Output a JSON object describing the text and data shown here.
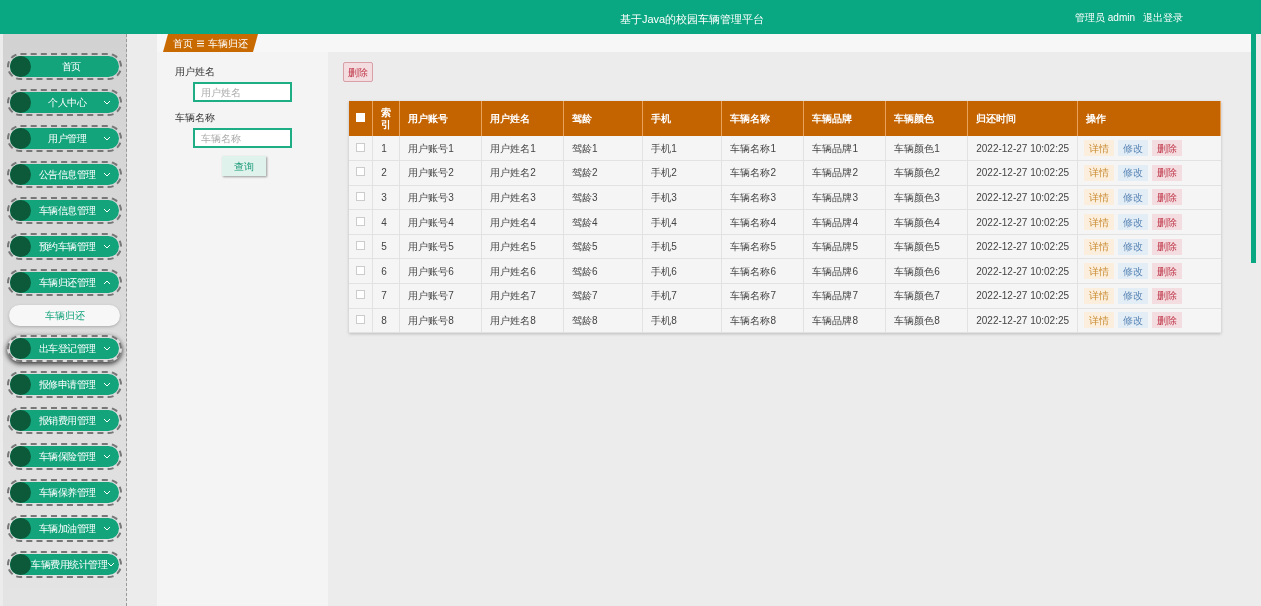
{
  "header": {
    "title": "基于Java的校园车辆管理平台",
    "user": "管理员 admin",
    "logout": "退出登录"
  },
  "sidebar": {
    "items": [
      {
        "label": "首页",
        "kind": "link",
        "hovered": false
      },
      {
        "label": "个人中心",
        "kind": "group",
        "expanded": false,
        "hovered": false
      },
      {
        "label": "用户管理",
        "kind": "group",
        "expanded": false,
        "hovered": false
      },
      {
        "label": "公告信息管理",
        "kind": "group",
        "expanded": false,
        "hovered": false
      },
      {
        "label": "车辆信息管理",
        "kind": "group",
        "expanded": false,
        "hovered": false
      },
      {
        "label": "预约车辆管理",
        "kind": "group",
        "expanded": false,
        "hovered": false
      },
      {
        "label": "车辆归还管理",
        "kind": "group",
        "expanded": true,
        "hovered": false,
        "children": [
          {
            "label": "车辆归还"
          }
        ]
      },
      {
        "label": "出车登记管理",
        "kind": "group",
        "expanded": false,
        "hovered": true
      },
      {
        "label": "报修申请管理",
        "kind": "group",
        "expanded": false,
        "hovered": false
      },
      {
        "label": "报销费用管理",
        "kind": "group",
        "expanded": false,
        "hovered": false
      },
      {
        "label": "车辆保险管理",
        "kind": "group",
        "expanded": false,
        "hovered": false
      },
      {
        "label": "车辆保养管理",
        "kind": "group",
        "expanded": false,
        "hovered": false
      },
      {
        "label": "车辆加油管理",
        "kind": "group",
        "expanded": false,
        "hovered": false
      },
      {
        "label": "车辆费用统计管理",
        "kind": "group",
        "expanded": false,
        "hovered": false
      }
    ]
  },
  "breadcrumb": [
    "首页",
    "车辆归还"
  ],
  "search": {
    "fields": [
      {
        "label": "用户姓名",
        "placeholder": "用户姓名"
      },
      {
        "label": "车辆名称",
        "placeholder": "车辆名称"
      }
    ],
    "button": "查询"
  },
  "toolbar": {
    "delete": "删除"
  },
  "table": {
    "columns": [
      "索引",
      "用户账号",
      "用户姓名",
      "驾龄",
      "手机",
      "车辆名称",
      "车辆品牌",
      "车辆颜色",
      "归还时间",
      "操作"
    ],
    "select_all": false,
    "rows": [
      {
        "checked": false,
        "cells": [
          "1",
          "用户账号1",
          "用户姓名1",
          "驾龄1",
          "手机1",
          "车辆名称1",
          "车辆品牌1",
          "车辆颜色1",
          "2022-12-27 10:02:25"
        ],
        "actions": [
          {
            "label": "详情",
            "kind": "detail"
          },
          {
            "label": "修改",
            "kind": "edit"
          },
          {
            "label": "删除",
            "kind": "delete"
          }
        ]
      },
      {
        "checked": false,
        "cells": [
          "2",
          "用户账号2",
          "用户姓名2",
          "驾龄2",
          "手机2",
          "车辆名称2",
          "车辆品牌2",
          "车辆颜色2",
          "2022-12-27 10:02:25"
        ],
        "actions": [
          {
            "label": "详情",
            "kind": "detail"
          },
          {
            "label": "修改",
            "kind": "edit"
          },
          {
            "label": "删除",
            "kind": "delete"
          }
        ]
      },
      {
        "checked": false,
        "cells": [
          "3",
          "用户账号3",
          "用户姓名3",
          "驾龄3",
          "手机3",
          "车辆名称3",
          "车辆品牌3",
          "车辆颜色3",
          "2022-12-27 10:02:25"
        ],
        "actions": [
          {
            "label": "详情",
            "kind": "detail"
          },
          {
            "label": "修改",
            "kind": "edit"
          },
          {
            "label": "删除",
            "kind": "delete"
          }
        ]
      },
      {
        "checked": false,
        "cells": [
          "4",
          "用户账号4",
          "用户姓名4",
          "驾龄4",
          "手机4",
          "车辆名称4",
          "车辆品牌4",
          "车辆颜色4",
          "2022-12-27 10:02:25"
        ],
        "actions": [
          {
            "label": "详情",
            "kind": "detail"
          },
          {
            "label": "修改",
            "kind": "edit"
          },
          {
            "label": "删除",
            "kind": "delete"
          }
        ]
      },
      {
        "checked": false,
        "cells": [
          "5",
          "用户账号5",
          "用户姓名5",
          "驾龄5",
          "手机5",
          "车辆名称5",
          "车辆品牌5",
          "车辆颜色5",
          "2022-12-27 10:02:25"
        ],
        "actions": [
          {
            "label": "详情",
            "kind": "detail"
          },
          {
            "label": "修改",
            "kind": "edit"
          },
          {
            "label": "删除",
            "kind": "delete"
          }
        ]
      },
      {
        "checked": false,
        "cells": [
          "6",
          "用户账号6",
          "用户姓名6",
          "驾龄6",
          "手机6",
          "车辆名称6",
          "车辆品牌6",
          "车辆颜色6",
          "2022-12-27 10:02:25"
        ],
        "actions": [
          {
            "label": "详情",
            "kind": "detail"
          },
          {
            "label": "修改",
            "kind": "edit"
          },
          {
            "label": "删除",
            "kind": "delete"
          }
        ]
      },
      {
        "checked": false,
        "cells": [
          "7",
          "用户账号7",
          "用户姓名7",
          "驾龄7",
          "手机7",
          "车辆名称7",
          "车辆品牌7",
          "车辆颜色7",
          "2022-12-27 10:02:25"
        ],
        "actions": [
          {
            "label": "详情",
            "kind": "detail"
          },
          {
            "label": "修改",
            "kind": "edit"
          },
          {
            "label": "删除",
            "kind": "delete"
          }
        ]
      },
      {
        "checked": false,
        "cells": [
          "8",
          "用户账号8",
          "用户姓名8",
          "驾龄8",
          "手机8",
          "车辆名称8",
          "车辆品牌8",
          "车辆颜色8",
          "2022-12-27 10:02:25"
        ],
        "actions": [
          {
            "label": "详情",
            "kind": "detail"
          },
          {
            "label": "修改",
            "kind": "edit"
          },
          {
            "label": "删除",
            "kind": "delete"
          }
        ]
      }
    ]
  }
}
